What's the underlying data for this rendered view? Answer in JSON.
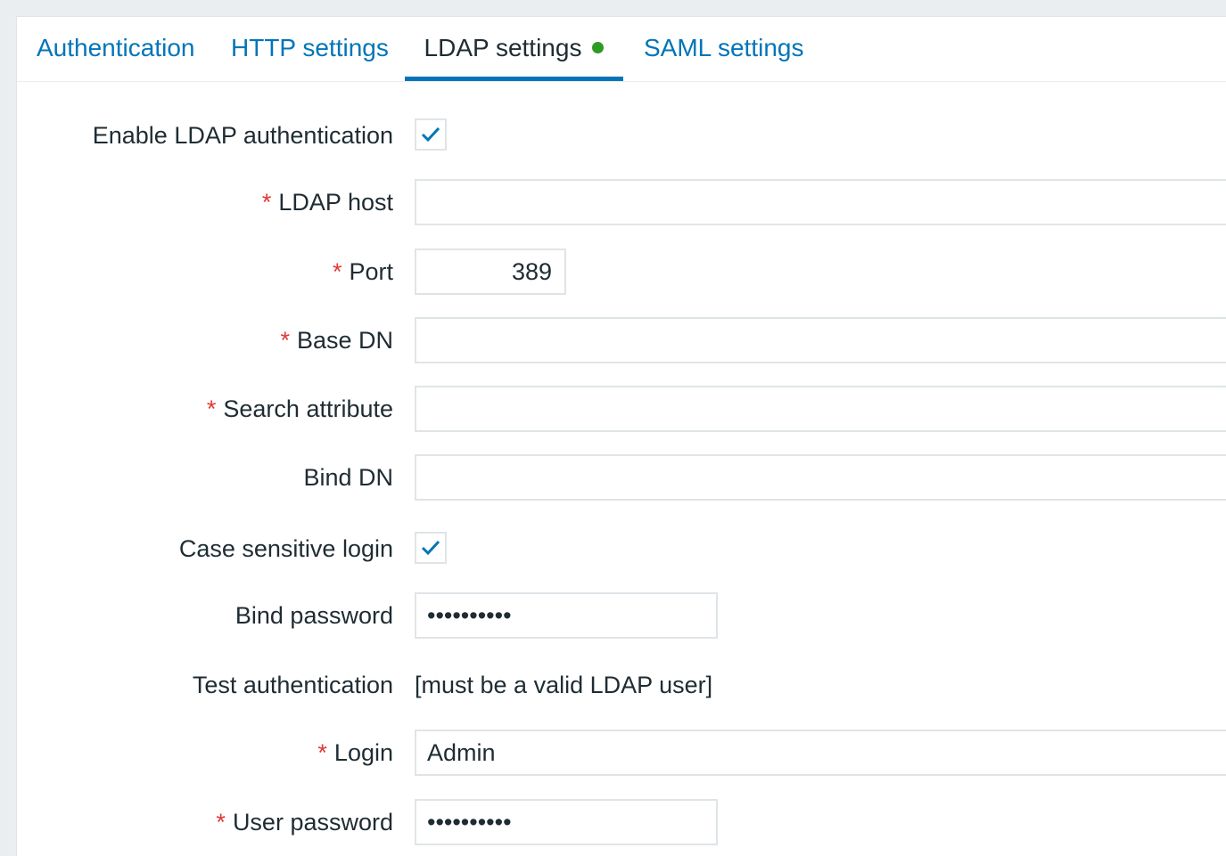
{
  "tabs": [
    {
      "label": "Authentication"
    },
    {
      "label": "HTTP settings"
    },
    {
      "label": "LDAP settings"
    },
    {
      "label": "SAML settings"
    }
  ],
  "form": {
    "enable_ldap": {
      "label": "Enable LDAP authentication",
      "checked": true
    },
    "ldap_host": {
      "label": "LDAP host",
      "required": true,
      "value": ""
    },
    "port": {
      "label": "Port",
      "required": true,
      "value": "389"
    },
    "base_dn": {
      "label": "Base DN",
      "required": true,
      "value": ""
    },
    "search_attribute": {
      "label": "Search attribute",
      "required": true,
      "value": ""
    },
    "bind_dn": {
      "label": "Bind DN",
      "value": ""
    },
    "case_sensitive": {
      "label": "Case sensitive login",
      "checked": true
    },
    "bind_password": {
      "label": "Bind password",
      "value": "••••••••••"
    },
    "test_auth": {
      "label": "Test authentication",
      "note": "[must be a valid LDAP user]"
    },
    "login": {
      "label": "Login",
      "required": true,
      "value": "Admin"
    },
    "user_password": {
      "label": "User password",
      "required": true,
      "value": "••••••••••"
    },
    "required_marker": "*"
  },
  "colors": {
    "link": "#0275b8",
    "active_dot": "#2e9b22",
    "required": "#e33734",
    "check": "#0275b8"
  }
}
